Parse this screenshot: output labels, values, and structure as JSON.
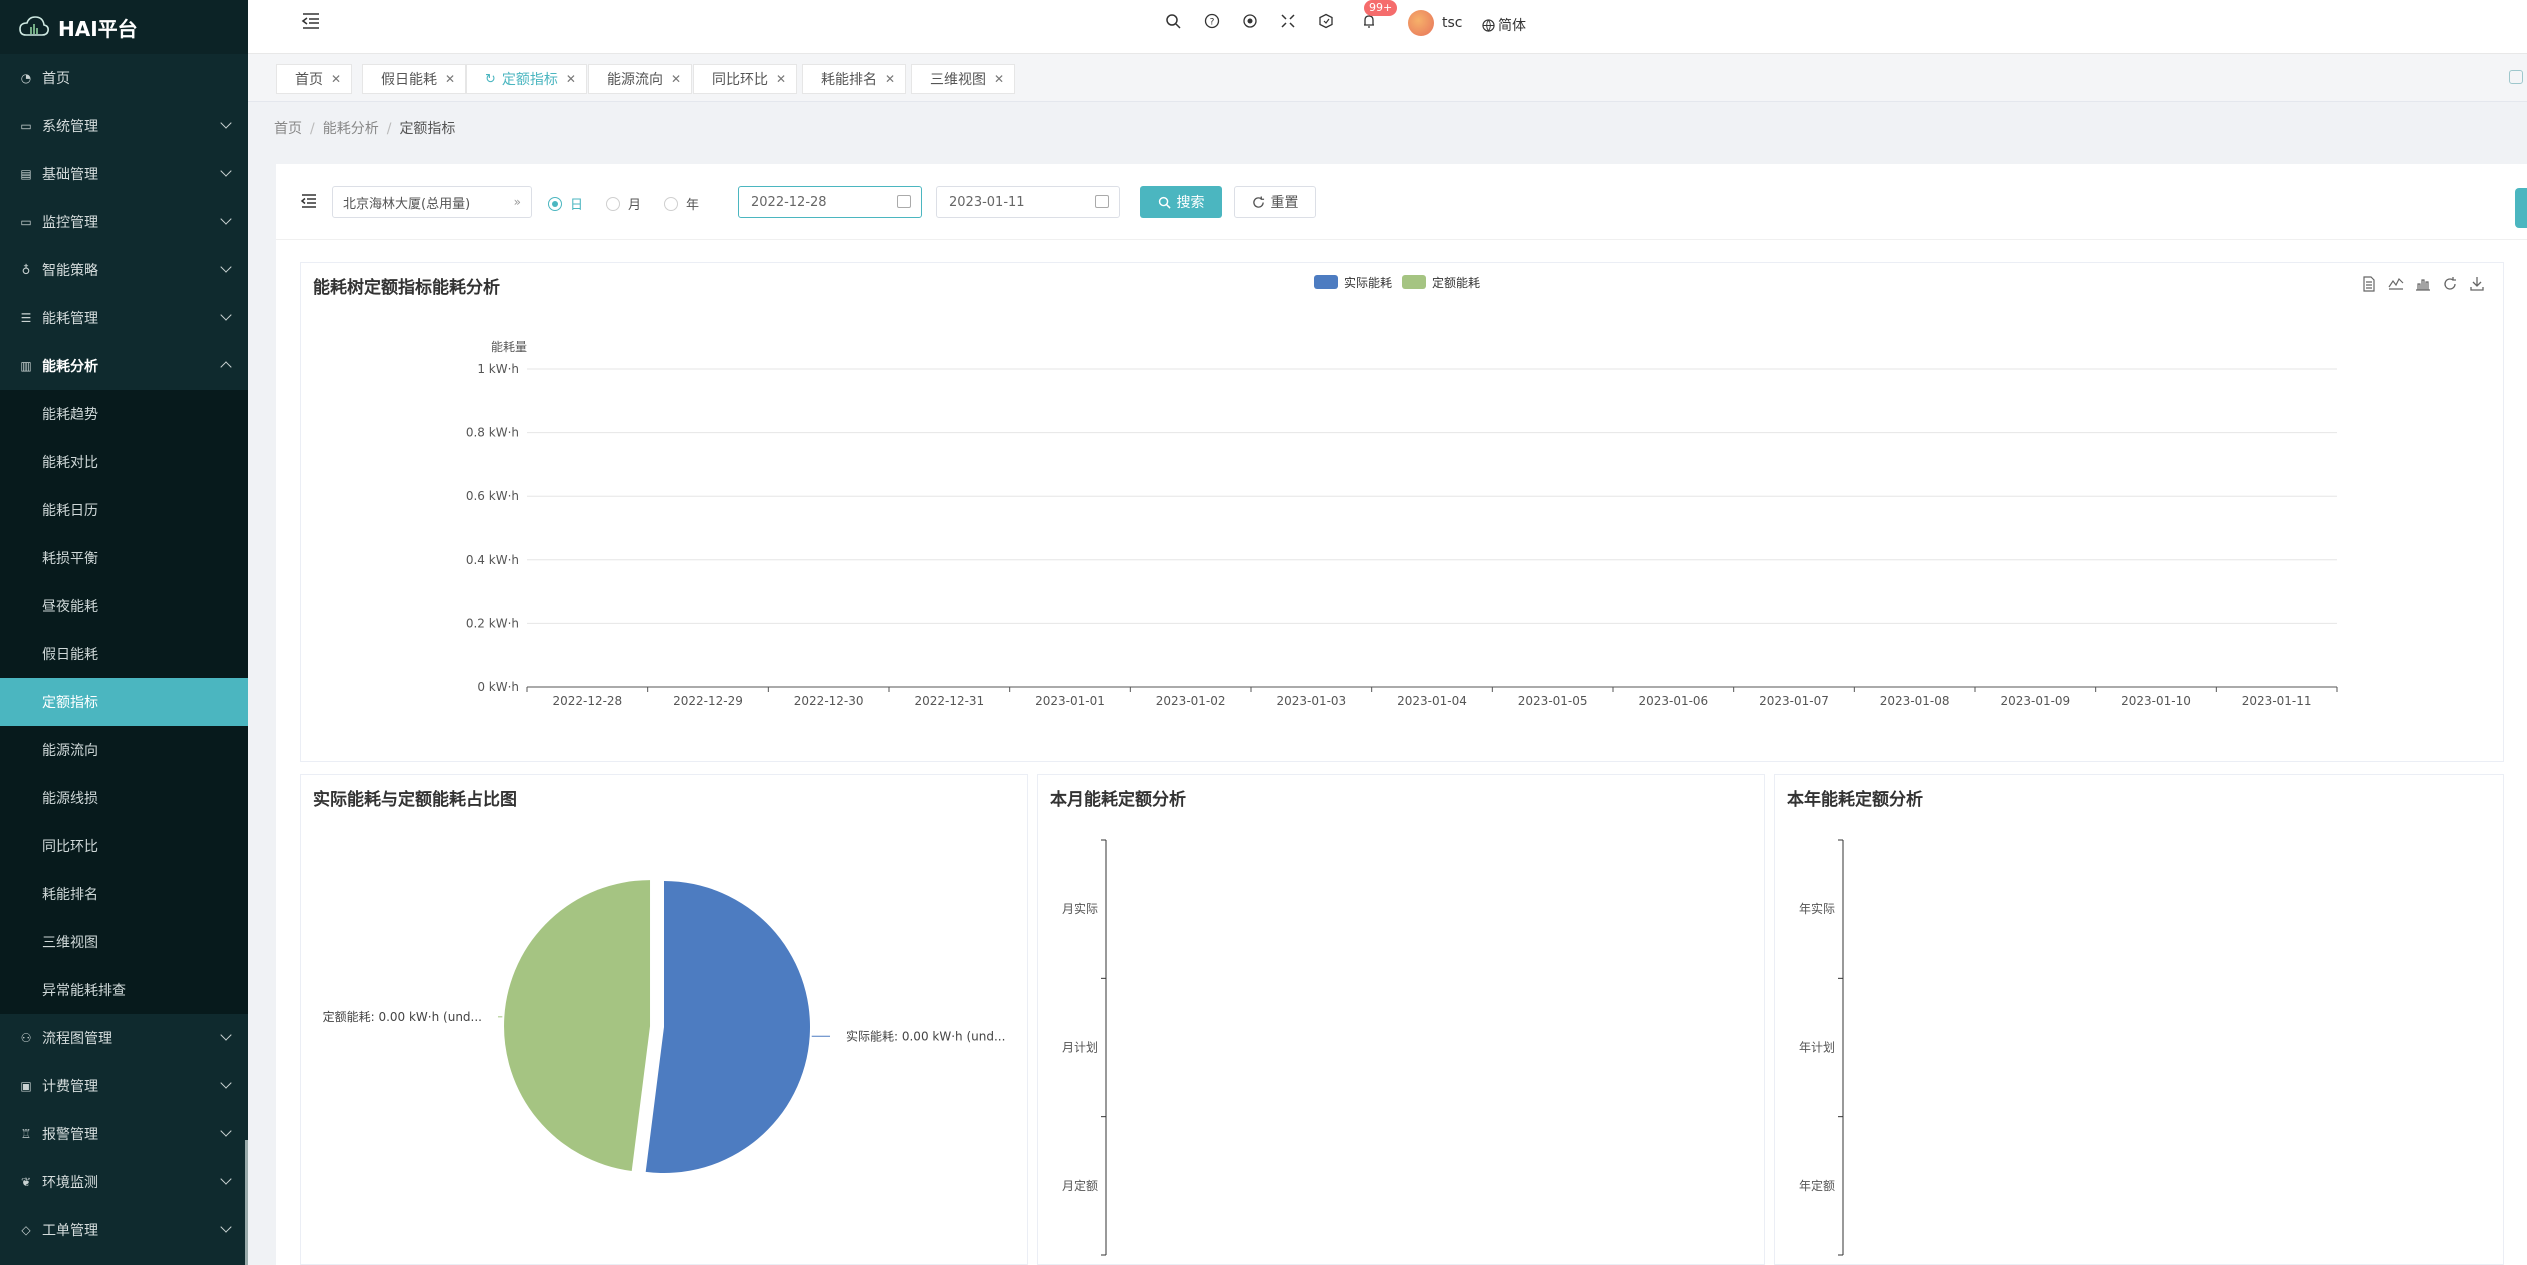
{
  "app": {
    "title": "HAI平台"
  },
  "sidebar": {
    "items": [
      {
        "label": "首页",
        "icon": "dashboard-icon",
        "expandable": false
      },
      {
        "label": "系统管理",
        "icon": "monitor-icon",
        "expandable": true
      },
      {
        "label": "基础管理",
        "icon": "database-icon",
        "expandable": true
      },
      {
        "label": "监控管理",
        "icon": "monitor-icon",
        "expandable": true
      },
      {
        "label": "智能策略",
        "icon": "bulb-icon",
        "expandable": true
      },
      {
        "label": "能耗管理",
        "icon": "sliders-icon",
        "expandable": true
      },
      {
        "label": "能耗分析",
        "icon": "chart-icon",
        "expandable": true,
        "open": true
      }
    ],
    "submenu": [
      "能耗趋势",
      "能耗对比",
      "能耗日历",
      "耗损平衡",
      "昼夜能耗",
      "假日能耗",
      "定额指标",
      "能源流向",
      "能源线损",
      "同比环比",
      "耗能排名",
      "三维视图",
      "异常能耗排查"
    ],
    "active_sub": "定额指标",
    "items_after": [
      {
        "label": "流程图管理",
        "icon": "flow-icon"
      },
      {
        "label": "计费管理",
        "icon": "billing-icon"
      },
      {
        "label": "报警管理",
        "icon": "alarm-icon"
      },
      {
        "label": "环境监测",
        "icon": "leaf-icon"
      },
      {
        "label": "工单管理",
        "icon": "ticket-icon"
      }
    ]
  },
  "header": {
    "icons": [
      "search-icon",
      "help-icon",
      "github-icon",
      "fullscreen-icon",
      "size-icon",
      "bell-icon"
    ],
    "notification_badge": "99+",
    "username": "tsc",
    "language": "简体"
  },
  "tabs": [
    {
      "label": "首页",
      "active": false
    },
    {
      "label": "假日能耗",
      "active": false
    },
    {
      "label": "定额指标",
      "active": true
    },
    {
      "label": "能源流向",
      "active": false
    },
    {
      "label": "同比环比",
      "active": false
    },
    {
      "label": "耗能排名",
      "active": false
    },
    {
      "label": "三维视图",
      "active": false
    }
  ],
  "breadcrumb": [
    "首页",
    "能耗分析",
    "定额指标"
  ],
  "filters": {
    "building": "北京海林大厦(总用量)",
    "period_options": [
      "日",
      "月",
      "年"
    ],
    "period_selected": "日",
    "start_date": "2022-12-28",
    "end_date": "2023-01-11",
    "search_label": "搜索",
    "reset_label": "重置"
  },
  "line_chart": {
    "title": "能耗树定额指标能耗分析",
    "legend": [
      {
        "name": "实际能耗",
        "color": "#4d7cc1"
      },
      {
        "name": "定额能耗",
        "color": "#a5c482"
      }
    ],
    "y_axis_name": "能耗量",
    "toolbox": [
      "data-view-icon",
      "line-chart-icon",
      "bar-chart-icon",
      "restore-icon",
      "download-icon"
    ]
  },
  "chart_data": [
    {
      "type": "line",
      "title": "能耗树定额指标能耗分析",
      "ylabel": "能耗量",
      "x": [
        "2022-12-28",
        "2022-12-29",
        "2022-12-30",
        "2022-12-31",
        "2023-01-01",
        "2023-01-02",
        "2023-01-03",
        "2023-01-04",
        "2023-01-05",
        "2023-01-06",
        "2023-01-07",
        "2023-01-08",
        "2023-01-09",
        "2023-01-10",
        "2023-01-11"
      ],
      "y_ticks": [
        "0 kW·h",
        "0.2 kW·h",
        "0.4 kW·h",
        "0.6 kW·h",
        "0.8 kW·h",
        "1 kW·h"
      ],
      "ylim": [
        0,
        1
      ],
      "series": [
        {
          "name": "实际能耗",
          "values": []
        },
        {
          "name": "定额能耗",
          "values": []
        }
      ],
      "legend_position": "top-center",
      "grid": true
    },
    {
      "type": "pie",
      "title": "实际能耗与定额能耗占比图",
      "slices": [
        {
          "name": "实际能耗",
          "value": 0.52,
          "label": "实际能耗: 0.00 kW·h (und...",
          "color": "#4d7cc1"
        },
        {
          "name": "定额能耗",
          "value": 0.48,
          "label": "定额能耗: 0.00 kW·h (und...",
          "color": "#a5c482"
        }
      ]
    },
    {
      "type": "bar",
      "title": "本月能耗定额分析",
      "categories": [
        "月实际",
        "月计划",
        "月定额"
      ],
      "values": []
    },
    {
      "type": "bar",
      "title": "本年能耗定额分析",
      "categories": [
        "年实际",
        "年计划",
        "年定额"
      ],
      "values": []
    }
  ],
  "colors": {
    "accent": "#4bb6c0",
    "sidebar_bg": "#0f2a2e"
  }
}
